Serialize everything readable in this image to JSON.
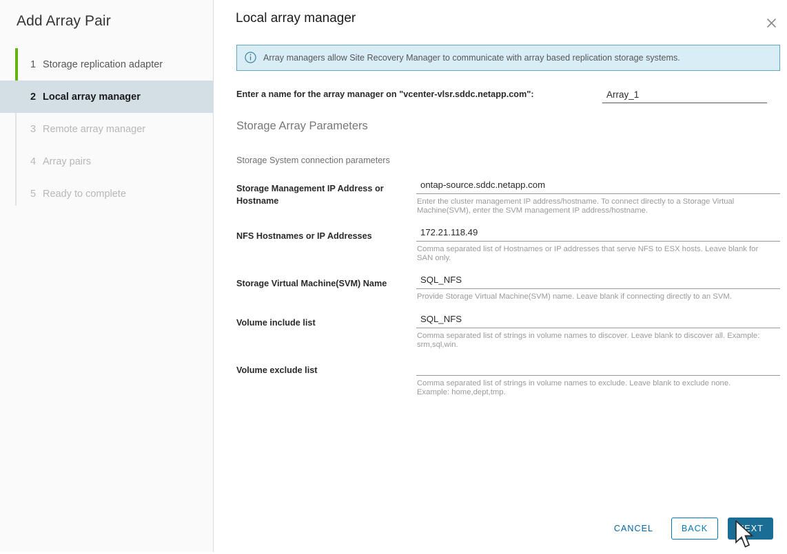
{
  "wizard": {
    "title": "Add Array Pair",
    "accent_green": "#60b515",
    "active_highlight": "#d3dee5",
    "steps": [
      {
        "num": "1",
        "label": "Storage replication adapter",
        "state": "done"
      },
      {
        "num": "2",
        "label": "Local array manager",
        "state": "active"
      },
      {
        "num": "3",
        "label": "Remote array manager",
        "state": "disabled"
      },
      {
        "num": "4",
        "label": "Array pairs",
        "state": "disabled"
      },
      {
        "num": "5",
        "label": "Ready to complete",
        "state": "disabled"
      }
    ]
  },
  "panel": {
    "title": "Local array manager",
    "close_icon": "close-icon",
    "banner": {
      "icon": "info-circle-icon",
      "text": "Array managers allow Site Recovery Manager to communicate with array based replication storage systems.",
      "background": "#d9edf7",
      "border_color": "#60a5bd"
    },
    "name_field": {
      "label": "Enter a name for the array manager on \"vcenter-vlsr.sddc.netapp.com\":",
      "value": "Array_1",
      "placeholder": ""
    },
    "section_heading": "Storage Array Parameters",
    "subsection_heading": "Storage System connection parameters",
    "parameters": [
      {
        "label": "Storage Management IP Address or Hostname",
        "value": "ontap-source.sddc.netapp.com",
        "placeholder": "",
        "hint": "Enter the cluster management IP address/hostname. To connect directly to a Storage Virtual Machine(SVM), enter the SVM management IP address/hostname."
      },
      {
        "label": "NFS Hostnames or IP Addresses",
        "value": "172.21.118.49",
        "placeholder": "",
        "hint": "Comma separated list of Hostnames or IP addresses that serve NFS to ESX hosts. Leave blank for SAN only."
      },
      {
        "label": "Storage Virtual Machine(SVM) Name",
        "value": "SQL_NFS",
        "placeholder": "",
        "hint": "Provide Storage Virtual Machine(SVM) name. Leave blank if connecting directly to an SVM."
      },
      {
        "label": "Volume include list",
        "value": "SQL_NFS",
        "placeholder": "",
        "hint": "Comma separated list of strings in volume names to discover. Leave blank to discover all. Example: srm,sql,win."
      },
      {
        "label": "Volume exclude list",
        "value": "",
        "placeholder": "",
        "hint": "Comma separated list of strings in volume names to exclude. Leave blank to exclude none. Example: home,dept,tmp."
      }
    ],
    "footer": {
      "cancel_label": "CANCEL",
      "back_label": "BACK",
      "next_label": "NEXT",
      "next_color": "#1a6e96",
      "link_color": "#0079b8"
    }
  }
}
